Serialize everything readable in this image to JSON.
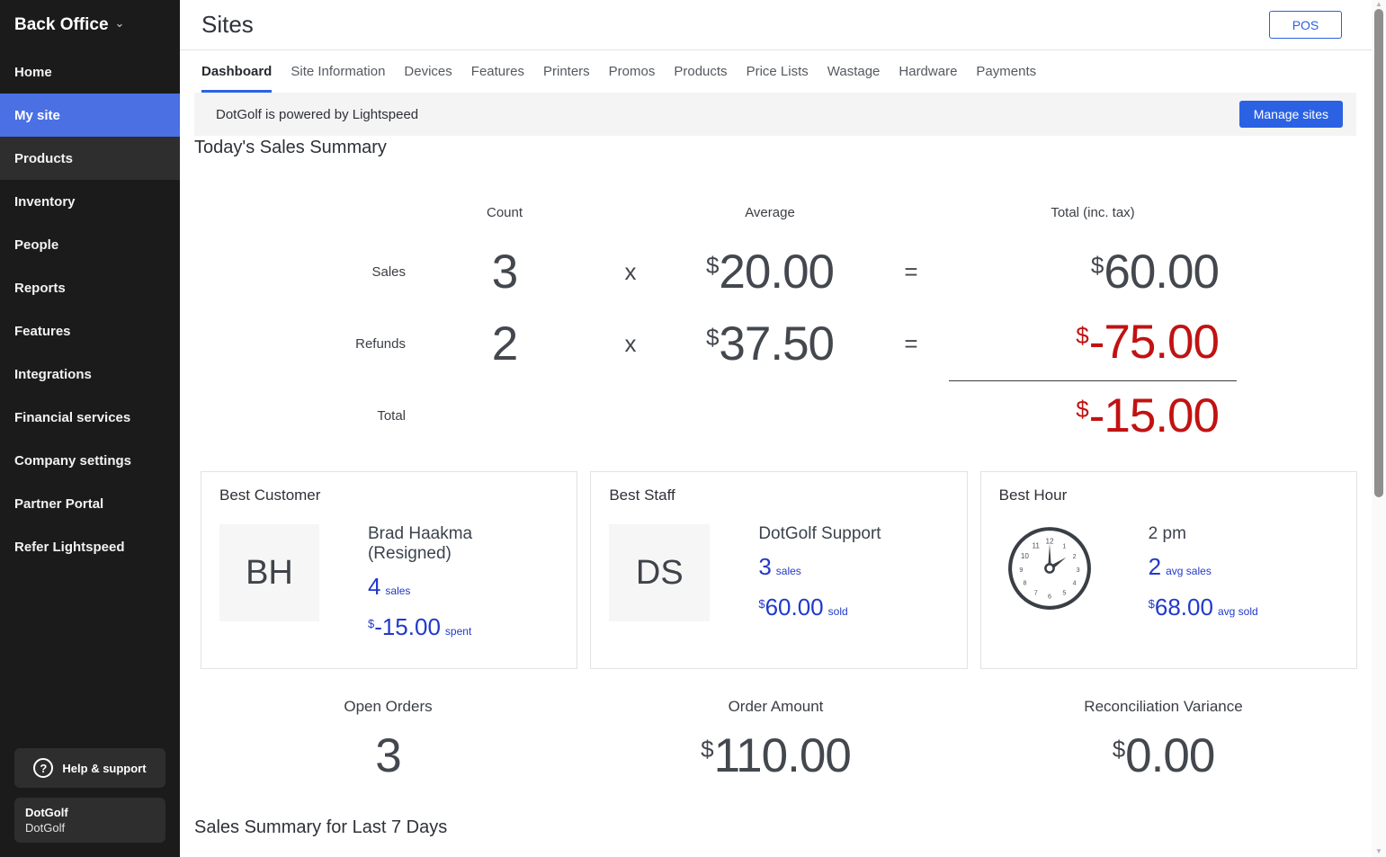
{
  "sidebar": {
    "title": "Back Office",
    "items": [
      {
        "label": "Home",
        "state": "default"
      },
      {
        "label": "My site",
        "state": "active"
      },
      {
        "label": "Products",
        "state": "highlight"
      },
      {
        "label": "Inventory",
        "state": "default"
      },
      {
        "label": "People",
        "state": "default"
      },
      {
        "label": "Reports",
        "state": "default"
      },
      {
        "label": "Features",
        "state": "default"
      },
      {
        "label": "Integrations",
        "state": "default"
      },
      {
        "label": "Financial services",
        "state": "default"
      },
      {
        "label": "Company settings",
        "state": "default"
      },
      {
        "label": "Partner Portal",
        "state": "default"
      },
      {
        "label": "Refer Lightspeed",
        "state": "default"
      }
    ],
    "help_label": "Help & support",
    "account": {
      "name": "DotGolf",
      "subtitle": "DotGolf"
    }
  },
  "header": {
    "title": "Sites",
    "pos_button": "POS"
  },
  "tabs": [
    {
      "label": "Dashboard",
      "active": true
    },
    {
      "label": "Site Information",
      "active": false
    },
    {
      "label": "Devices",
      "active": false
    },
    {
      "label": "Features",
      "active": false
    },
    {
      "label": "Printers",
      "active": false
    },
    {
      "label": "Promos",
      "active": false
    },
    {
      "label": "Products",
      "active": false
    },
    {
      "label": "Price Lists",
      "active": false
    },
    {
      "label": "Wastage",
      "active": false
    },
    {
      "label": "Hardware",
      "active": false
    },
    {
      "label": "Payments",
      "active": false
    }
  ],
  "banner": {
    "text": "DotGolf is powered by Lightspeed",
    "button": "Manage sites"
  },
  "sales_summary": {
    "heading": "Today's Sales Summary",
    "columns": [
      "Count",
      "Average",
      "Total (inc. tax)"
    ],
    "multiply_symbol": "x",
    "equals_symbol": "=",
    "rows": [
      {
        "label": "Sales",
        "count": "3",
        "average_currency": "$",
        "average": "20.00",
        "total_currency": "$",
        "total": "60.00",
        "negative": false
      },
      {
        "label": "Refunds",
        "count": "2",
        "average_currency": "$",
        "average": "37.50",
        "total_currency": "$",
        "total": "-75.00",
        "negative": true
      }
    ],
    "total_row": {
      "label": "Total",
      "currency": "$",
      "value": "-15.00",
      "negative": true
    }
  },
  "cards": [
    {
      "title": "Best Customer",
      "avatar": "BH",
      "name": "Brad Haakma (Resigned)",
      "stat1_value": "4",
      "stat1_label": "sales",
      "stat2_currency": "$",
      "stat2_value": "-15.00",
      "stat2_label": "spent"
    },
    {
      "title": "Best Staff",
      "avatar": "DS",
      "name": "DotGolf Support",
      "stat1_value": "3",
      "stat1_label": "sales",
      "stat2_currency": "$",
      "stat2_value": "60.00",
      "stat2_label": "sold"
    },
    {
      "title": "Best Hour",
      "icon": "clock-icon",
      "name": "2 pm",
      "stat1_value": "2",
      "stat1_label": "avg sales",
      "stat2_currency": "$",
      "stat2_value": "68.00",
      "stat2_label": "avg sold"
    }
  ],
  "stats": [
    {
      "label": "Open Orders",
      "currency": "",
      "value": "3"
    },
    {
      "label": "Order Amount",
      "currency": "$",
      "value": "110.00"
    },
    {
      "label": "Reconciliation Variance",
      "currency": "$",
      "value": "0.00"
    }
  ],
  "bottom_heading": "Sales Summary for Last 7 Days",
  "icons": {
    "chevron_down": "⌄",
    "help": "?",
    "scroll_up": "▲",
    "scroll_down": "▼"
  },
  "colors": {
    "accent_blue": "#2b62e3",
    "sidebar_active_blue": "#4a70e4",
    "value_blue": "#2139cb",
    "negative_red": "#c11212",
    "sidebar_bg": "#1b1b1b",
    "banner_bg": "#f4f4f4"
  }
}
